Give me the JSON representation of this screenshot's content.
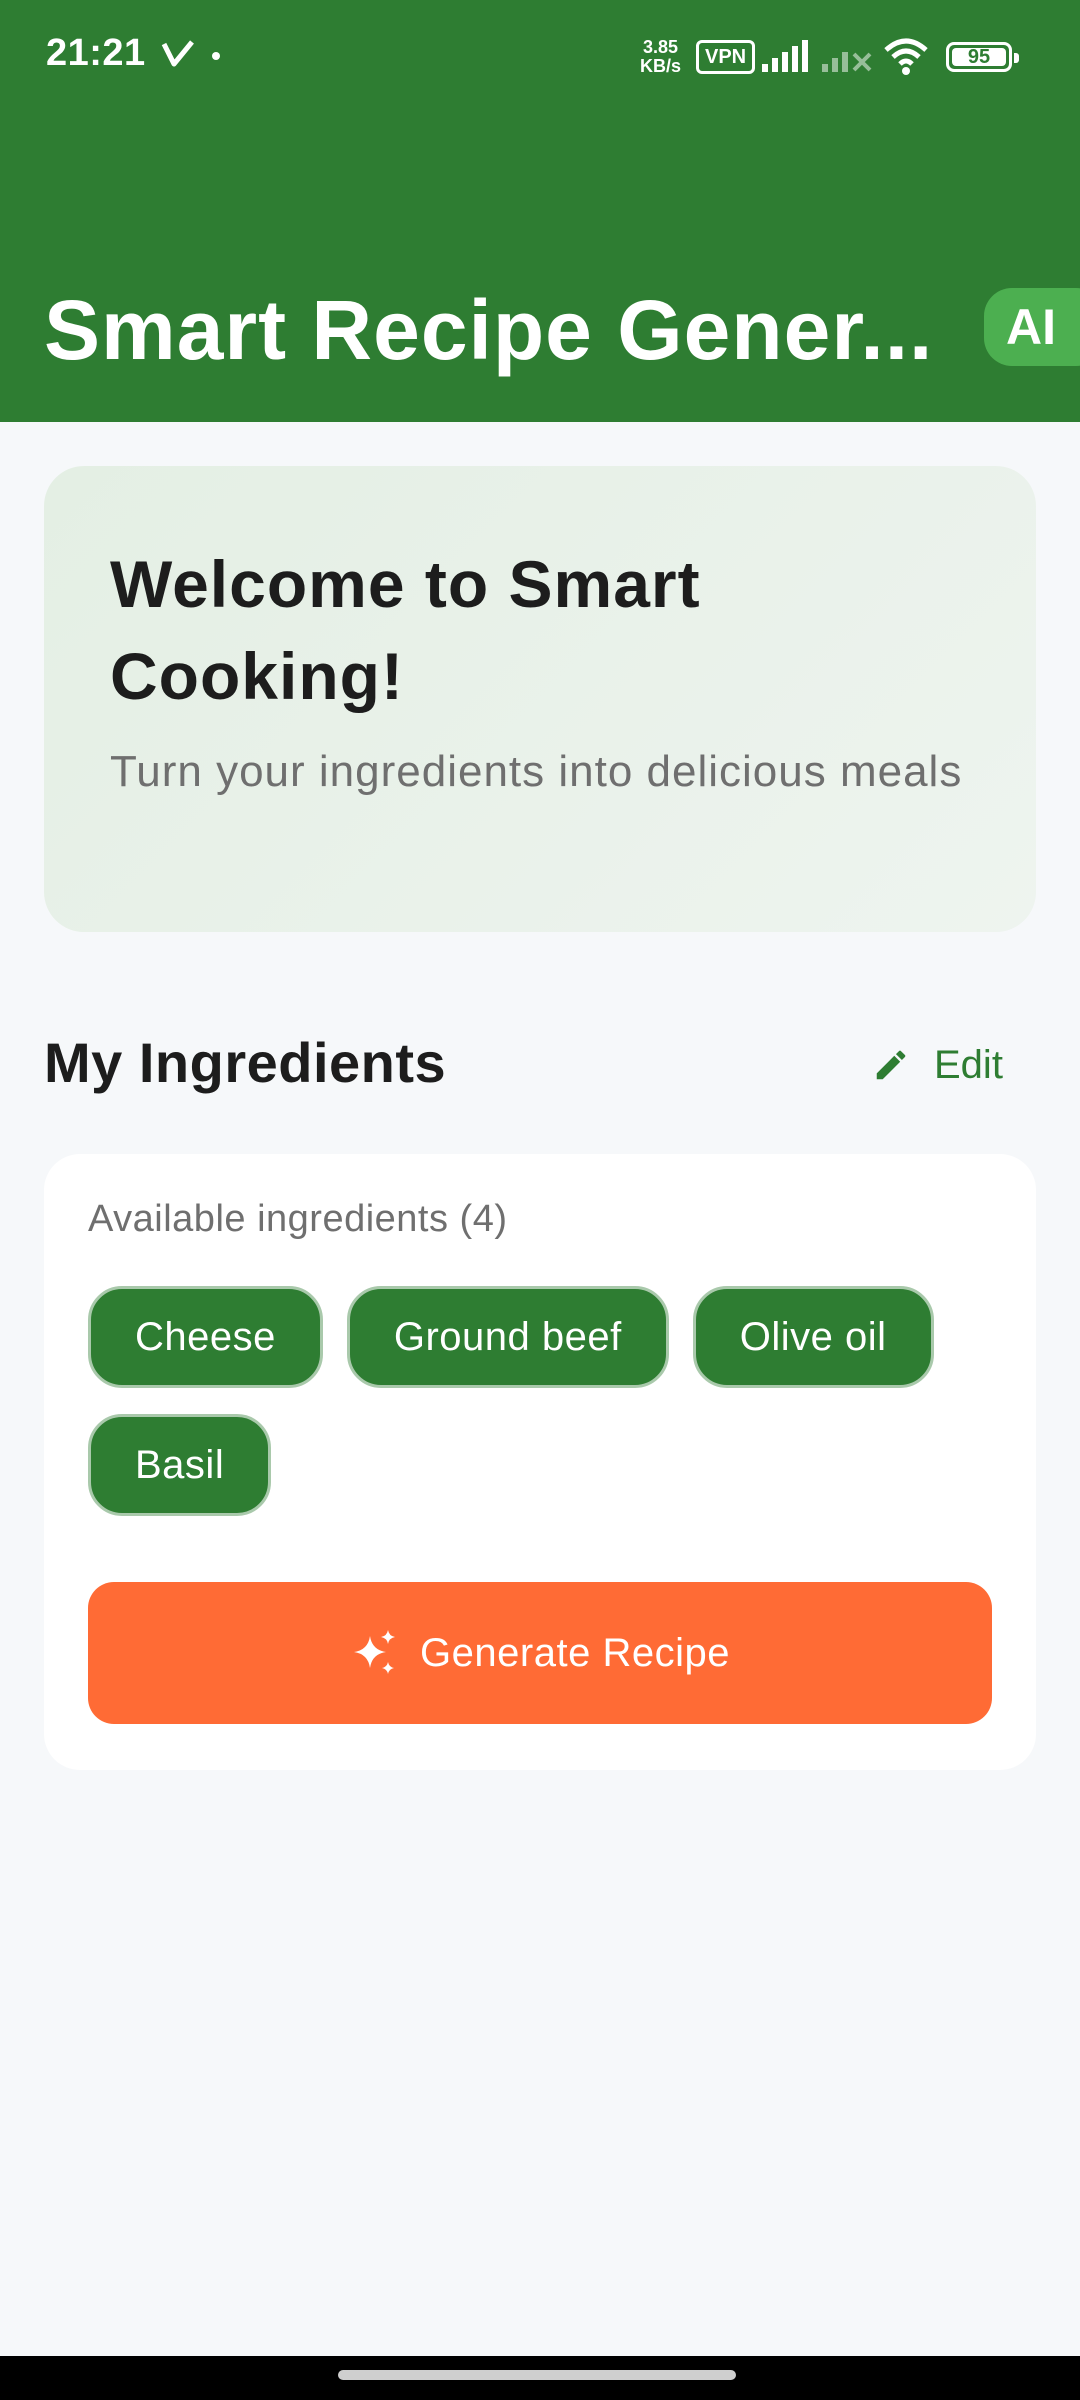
{
  "status_bar": {
    "time": "21:21",
    "speed_value": "3.85",
    "speed_unit": "KB/s",
    "vpn": "VPN",
    "battery": "95"
  },
  "header": {
    "title": "Smart Recipe Gener...",
    "badge": "AI",
    "background_color": "#2e7d32"
  },
  "welcome": {
    "title": "Welcome to Smart Cooking!",
    "subtitle": "Turn your ingredients into delicious meals"
  },
  "ingredients_section": {
    "title": "My Ingredients",
    "edit_label": "Edit",
    "edit_icon": "pencil-icon"
  },
  "ingredients_card": {
    "label": "Available ingredients (4)",
    "chips": [
      "Cheese",
      "Ground beef",
      "Olive oil",
      "Basil"
    ],
    "generate_label": "Generate Recipe",
    "generate_icon": "sparkle-icon",
    "accent_color": "#ff6b35"
  }
}
